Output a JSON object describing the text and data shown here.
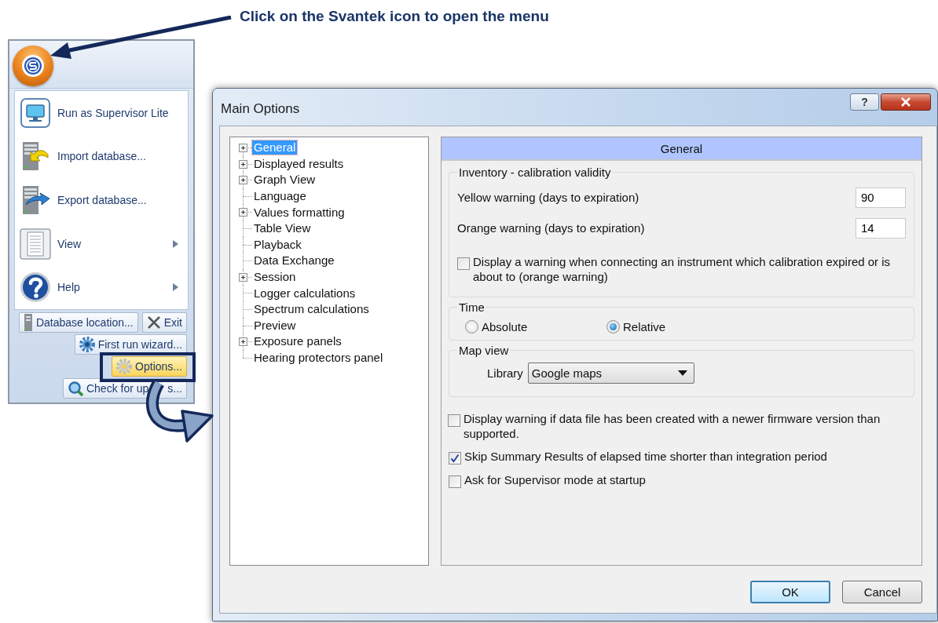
{
  "annotation": {
    "text": "Click on the Svantek icon to open the menu"
  },
  "app_menu": {
    "items": [
      {
        "label": "Run as Supervisor Lite",
        "kind": "monitor",
        "submenu": false
      },
      {
        "label": "Import database...",
        "kind": "import",
        "submenu": false
      },
      {
        "label": "Export database...",
        "kind": "export",
        "submenu": false
      },
      {
        "label": "View",
        "kind": "view",
        "submenu": true
      },
      {
        "label": "Help",
        "kind": "help",
        "submenu": true
      }
    ],
    "buttons": [
      {
        "parts": [
          "Database location..."
        ],
        "kind": "database",
        "highlighted": false
      },
      {
        "parts": [
          "Exit"
        ],
        "kind": "exit",
        "highlighted": false
      },
      {
        "parts": [
          "First run wizard..."
        ],
        "kind": "wizard",
        "highlighted": false
      },
      {
        "parts": [
          "Options..."
        ],
        "kind": "gear",
        "highlighted": true
      },
      {
        "parts": [
          "Check for up",
          "s..."
        ],
        "kind": "update",
        "highlighted": false
      }
    ]
  },
  "dialog": {
    "title": "Main Options",
    "help_button": "?",
    "tree": [
      {
        "label": "General",
        "kind": "group",
        "selected": true
      },
      {
        "label": "Displayed results",
        "kind": "group",
        "selected": false
      },
      {
        "label": "Graph View",
        "kind": "group",
        "selected": false
      },
      {
        "label": "Language",
        "kind": "leaf",
        "selected": false
      },
      {
        "label": "Values formatting",
        "kind": "group",
        "selected": false
      },
      {
        "label": "Table View",
        "kind": "leaf",
        "selected": false
      },
      {
        "label": "Playback",
        "kind": "leaf",
        "selected": false
      },
      {
        "label": "Data Exchange",
        "kind": "leaf",
        "selected": false
      },
      {
        "label": "Session",
        "kind": "group",
        "selected": false
      },
      {
        "label": "Logger calculations",
        "kind": "leaf",
        "selected": false
      },
      {
        "label": "Spectrum calculations",
        "kind": "leaf",
        "selected": false
      },
      {
        "label": "Preview",
        "kind": "leaf",
        "selected": false
      },
      {
        "label": "Exposure panels",
        "kind": "group",
        "selected": false
      },
      {
        "label": "Hearing protectors panel",
        "kind": "leaf",
        "selected": false
      }
    ],
    "panel_title": "General",
    "inventory": {
      "title": "Inventory - calibration validity",
      "fields": [
        {
          "label": "Yellow warning (days to expiration)",
          "value": "90"
        },
        {
          "label": "Orange warning (days to expiration)",
          "value": "14"
        }
      ],
      "checkbox": {
        "label": "Display a warning when connecting an instrument which calibration expired or is about to (orange warning)",
        "checked": false
      }
    },
    "time": {
      "title": "Time",
      "options": [
        {
          "label": "Absolute",
          "selected": false
        },
        {
          "label": "Relative",
          "selected": true
        }
      ]
    },
    "map_view": {
      "title": "Map view",
      "label": "Library",
      "value": "Google maps"
    },
    "checkboxes": [
      {
        "label": "Display warning if data file has been created with a newer firmware version than supported.",
        "checked": false
      },
      {
        "label": "Skip Summary Results of elapsed time shorter than integration period",
        "checked": true
      },
      {
        "label": "Ask for Supervisor mode at startup",
        "checked": false
      }
    ],
    "buttons": [
      {
        "label": "OK",
        "default": true
      },
      {
        "label": "Cancel",
        "default": false
      }
    ]
  }
}
